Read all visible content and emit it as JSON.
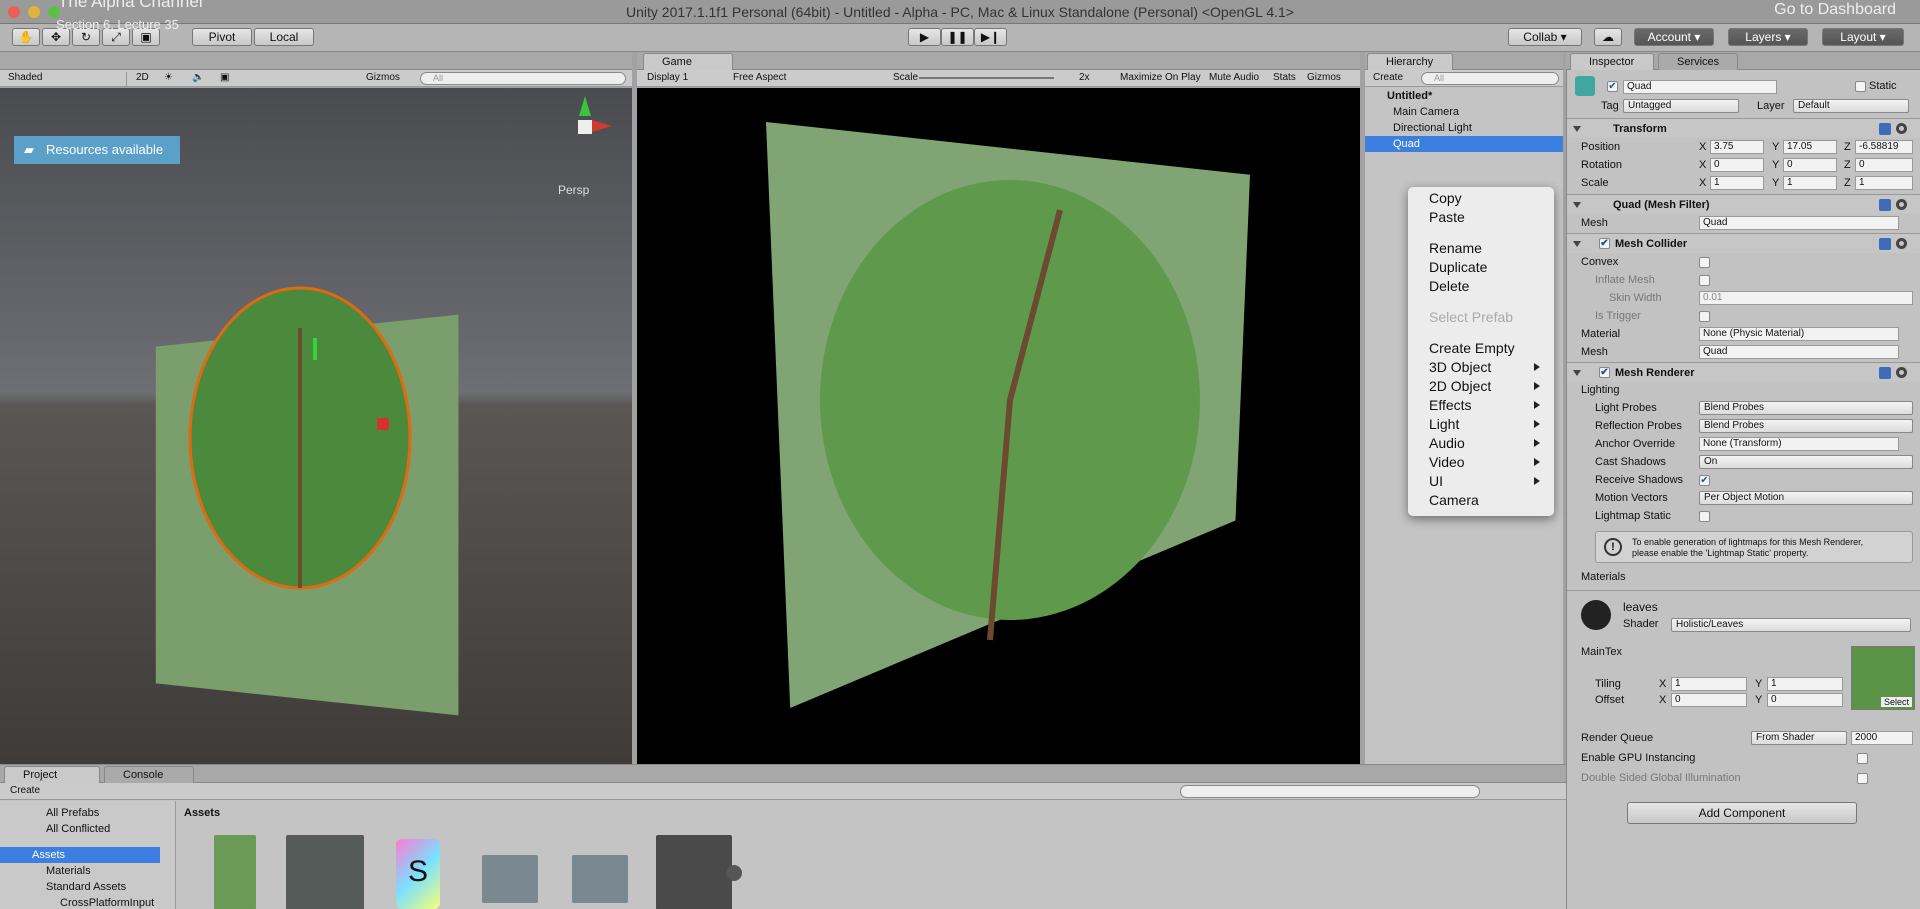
{
  "window": {
    "course_title": "The Alpha Channel",
    "course_subtitle": "Section 6, Lecture 35",
    "title": "Unity 2017.1.1f1 Personal (64bit) - Untitled - Alpha - PC, Mac & Linux Standalone (Personal) <OpenGL 4.1>",
    "dashboard_link": "Go to Dashboard",
    "resources_badge": "Resources available"
  },
  "toolbar": {
    "pivot": "Pivot",
    "local": "Local",
    "collab": "Collab",
    "account": "Account",
    "layers": "Layers",
    "layout": "Layout"
  },
  "scene": {
    "shading_mode": "Shaded",
    "mode_2d": "2D",
    "gizmos": "Gizmos",
    "search_placeholder": "All",
    "persp_label": "Persp"
  },
  "game": {
    "tab": "Game",
    "display": "Display 1",
    "aspect": "Free Aspect",
    "scale_label": "Scale",
    "scale_value": "2x",
    "maximize": "Maximize On Play",
    "mute": "Mute Audio",
    "stats": "Stats",
    "gizmos": "Gizmos"
  },
  "hierarchy": {
    "tab": "Hierarchy",
    "create": "Create",
    "search_placeholder": "All",
    "scene_name": "Untitled*",
    "items": [
      "Main Camera",
      "Directional Light",
      "Quad"
    ]
  },
  "context_menu": {
    "items": [
      "Copy",
      "Paste",
      "Rename",
      "Duplicate",
      "Delete",
      "Select Prefab",
      "Create Empty",
      "3D Object",
      "2D Object",
      "Effects",
      "Light",
      "Audio",
      "Video",
      "UI",
      "Camera"
    ]
  },
  "inspector": {
    "tab": "Inspector",
    "services_tab": "Services",
    "object_name": "Quad",
    "static_label": "Static",
    "tag_label": "Tag",
    "tag_value": "Untagged",
    "layer_label": "Layer",
    "layer_value": "Default",
    "transform": {
      "title": "Transform",
      "position_label": "Position",
      "pos_x": "3.75",
      "pos_y": "17.05",
      "pos_z": "-6.58819",
      "rotation_label": "Rotation",
      "rot_x": "0",
      "rot_y": "0",
      "rot_z": "0",
      "scale_label": "Scale",
      "scale_x": "1",
      "scale_y": "1",
      "scale_z": "1",
      "axis_x": "X",
      "axis_y": "Y",
      "axis_z": "Z"
    },
    "mesh_filter": {
      "title": "Quad (Mesh Filter)",
      "mesh_label": "Mesh",
      "mesh_value": "Quad"
    },
    "mesh_collider": {
      "title": "Mesh Collider",
      "convex": "Convex",
      "inflate": "Inflate Mesh",
      "skin_width": "Skin Width",
      "skin_value": "0.01",
      "is_trigger": "Is Trigger",
      "material_label": "Material",
      "material_value": "None (Physic Material)",
      "mesh_label": "Mesh",
      "mesh_value": "Quad"
    },
    "mesh_renderer": {
      "title": "Mesh Renderer",
      "lighting": "Lighting",
      "light_probes": "Light Probes",
      "light_probes_value": "Blend Probes",
      "reflection_probes": "Reflection Probes",
      "reflection_probes_value": "Blend Probes",
      "anchor_override": "Anchor Override",
      "anchor_value": "None (Transform)",
      "cast_shadows": "Cast Shadows",
      "cast_value": "On",
      "receive_shadows": "Receive Shadows",
      "motion_vectors": "Motion Vectors",
      "motion_value": "Per Object Motion",
      "lightmap_static": "Lightmap Static",
      "info_line1": "To enable generation of lightmaps for this Mesh Renderer,",
      "info_line2": "please enable the 'Lightmap Static' property.",
      "materials": "Materials"
    },
    "material": {
      "name": "leaves",
      "shader_label": "Shader",
      "shader_value": "Holistic/Leaves",
      "maintex": "MainTex",
      "tiling": "Tiling",
      "tiling_x": "1",
      "tiling_y": "1",
      "offset": "Offset",
      "offset_x": "0",
      "offset_y": "0",
      "select": "Select",
      "render_queue": "Render Queue",
      "render_queue_mode": "From Shader",
      "render_queue_value": "2000",
      "gpu_instancing": "Enable GPU Instancing",
      "double_sided": "Double Sided Global Illumination"
    },
    "add_component": "Add Component"
  },
  "project": {
    "tab": "Project",
    "console_tab": "Console",
    "create": "Create",
    "favorites": [
      "All Prefabs",
      "All Conflicted"
    ],
    "tree": [
      "Assets",
      "Materials",
      "Standard Assets",
      "CrossPlatformInput"
    ],
    "assets_header": "Assets",
    "shader_glyph": "S"
  }
}
